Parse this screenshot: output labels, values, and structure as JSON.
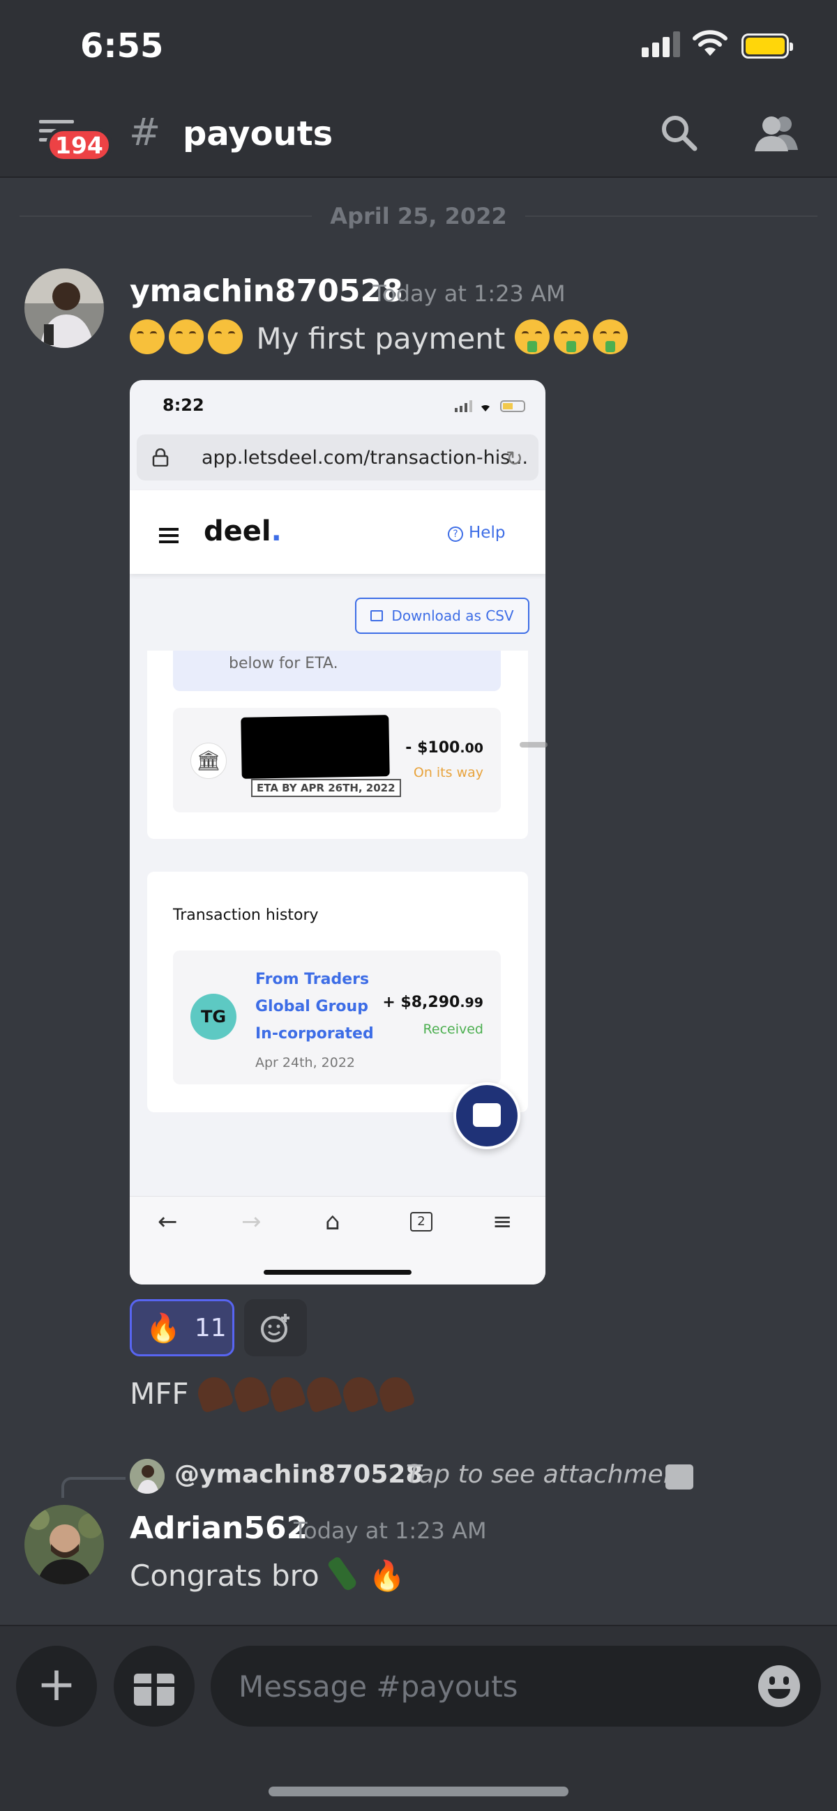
{
  "status_bar": {
    "time": "6:55"
  },
  "header": {
    "badge_count": "194",
    "channel_hash": "#",
    "channel_name": "payouts"
  },
  "date_divider": "April 25, 2022",
  "messages": [
    {
      "username": "ymachin870528",
      "timestamp": "Today at 1:23 AM",
      "text": "My first payment",
      "attachment": {
        "status_time": "8:22",
        "url": "app.letsdeel.com/transaction-his...",
        "logo": "deel",
        "help_label": "Help",
        "csv_label": "Download as CSV",
        "eta_text": "below for ETA.",
        "pending": {
          "amount_main": "- $100",
          "amount_cents": ".00",
          "status": "On its way",
          "eta": "ETA BY APR 26TH, 2022"
        },
        "history_title": "Transaction history",
        "transaction": {
          "initials": "TG",
          "name": "From Traders Global Group In-corporated",
          "date": "Apr 24th, 2022",
          "amount_main": "+ $8,290",
          "amount_cents": ".99",
          "status": "Received"
        },
        "nav_tab_count": "2"
      },
      "reaction": {
        "emoji": "fire",
        "count": "11"
      },
      "followup_text": "MFF"
    },
    {
      "reply_to": {
        "username": "@ymachin870528",
        "text": "Tap to see attachment"
      },
      "username": "Adrian562",
      "timestamp": "Today at 1:23 AM",
      "text": "Congrats bro"
    }
  ],
  "composer": {
    "placeholder": "Message #payouts"
  },
  "colors": {
    "background": "#36393f",
    "header": "#2f3136",
    "accent": "#5865f2",
    "badge": "#ed4245",
    "deel_blue": "#3d6de6"
  }
}
